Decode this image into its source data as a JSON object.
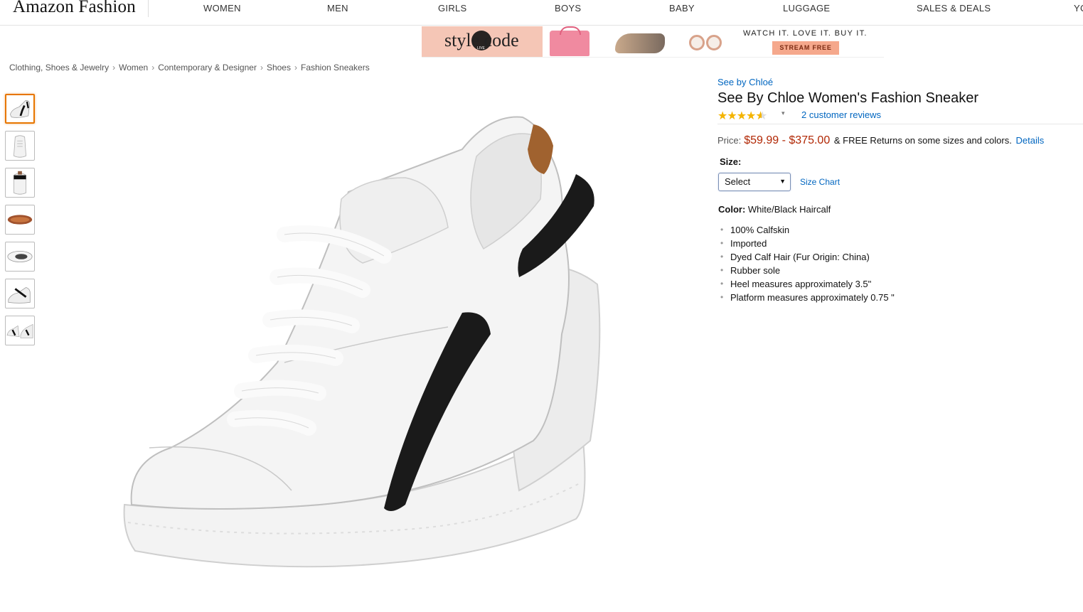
{
  "header": {
    "logo": "Amazon Fashion",
    "nav": [
      "WOMEN",
      "MEN",
      "GIRLS",
      "BOYS",
      "BABY",
      "LUGGAGE",
      "SALES & DEALS",
      "YO"
    ]
  },
  "banner": {
    "brand": "style code",
    "live": "LIVE",
    "tagline": "WATCH IT. LOVE IT. BUY IT.",
    "button": "STREAM FREE"
  },
  "breadcrumb": [
    "Clothing, Shoes & Jewelry",
    "Women",
    "Contemporary & Designer",
    "Shoes",
    "Fashion Sneakers"
  ],
  "breadcrumb_sep": "›",
  "product": {
    "brand": "See by Chloé",
    "title": "See By Chloe Women's Fashion Sneaker",
    "rating": 4.5,
    "stars": "★★★★",
    "half_star": "★",
    "reviews_caret": "▾",
    "reviews": "2 customer reviews",
    "price_label": "Price:",
    "price": "$59.99 - $375.00",
    "shipping": "& FREE Returns on some sizes and colors.",
    "details_link": "Details",
    "size_label": "Size:",
    "size_select": "Select",
    "size_select_arrow": "▼",
    "size_chart": "Size Chart",
    "color_label": "Color:",
    "color_value": "White/Black Haircalf",
    "features": [
      "100% Calfskin",
      "Imported",
      "Dyed Calf Hair (Fur Origin: China)",
      "Rubber sole",
      "Heel measures approximately 3.5\"",
      "Platform measures approximately 0.75 \""
    ]
  },
  "thumbnails_count": 7,
  "colors": {
    "link": "#0066c0",
    "price": "#b12704",
    "star": "#f4b400",
    "thumb_active": "#e77600"
  }
}
